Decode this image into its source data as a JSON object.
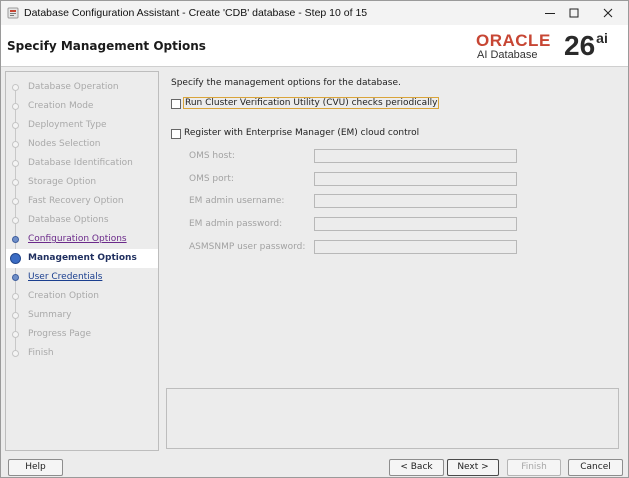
{
  "window": {
    "title": "Database Configuration Assistant - Create 'CDB' database - Step 10 of 15"
  },
  "header": {
    "page_title": "Specify Management Options",
    "brand_oracle": "ORACLE",
    "brand_sub": "AI Database",
    "brand_version": "26",
    "brand_version_suffix": "ai"
  },
  "steps": [
    {
      "label": "Database Operation",
      "state": "disabled"
    },
    {
      "label": "Creation Mode",
      "state": "disabled"
    },
    {
      "label": "Deployment Type",
      "state": "disabled"
    },
    {
      "label": "Nodes Selection",
      "state": "disabled"
    },
    {
      "label": "Database Identification",
      "state": "disabled"
    },
    {
      "label": "Storage Option",
      "state": "disabled"
    },
    {
      "label": "Fast Recovery Option",
      "state": "disabled"
    },
    {
      "label": "Database Options",
      "state": "disabled"
    },
    {
      "label": "Configuration Options",
      "state": "visited"
    },
    {
      "label": "Management Options",
      "state": "current"
    },
    {
      "label": "User Credentials",
      "state": "link"
    },
    {
      "label": "Creation Option",
      "state": "disabled"
    },
    {
      "label": "Summary",
      "state": "disabled"
    },
    {
      "label": "Progress Page",
      "state": "disabled"
    },
    {
      "label": "Finish",
      "state": "disabled"
    }
  ],
  "main": {
    "intro": "Specify the management options for the database.",
    "cvu_label": "Run Cluster Verification Utility (CVU) checks periodically",
    "cvu_checked": false,
    "em_label": "Register with Enterprise Manager (EM) cloud control",
    "em_checked": false,
    "fields": {
      "oms_host": {
        "label": "OMS host:",
        "value": ""
      },
      "oms_port": {
        "label": "OMS port:",
        "value": ""
      },
      "em_admin_username": {
        "label": "EM admin username:",
        "value": ""
      },
      "em_admin_password": {
        "label": "EM admin password:",
        "value": ""
      },
      "asmsnmp_password": {
        "label": "ASMSNMP user password:",
        "value": ""
      }
    }
  },
  "buttons": {
    "help": "Help",
    "back": "< Back",
    "next": "Next >",
    "finish": "Finish",
    "cancel": "Cancel"
  },
  "colors": {
    "oracle_red": "#c74634",
    "link_purple": "#6b2a8a",
    "link_blue": "#1b3f8f",
    "focus_outline": "#d9a43a"
  }
}
